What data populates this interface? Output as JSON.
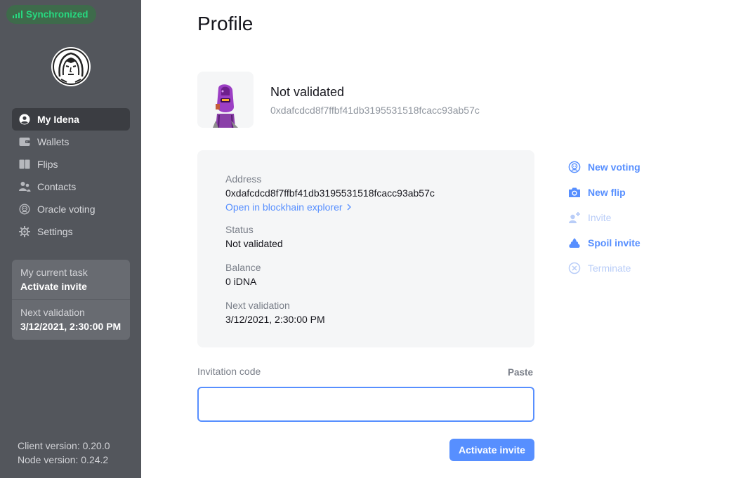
{
  "sidebar": {
    "sync_status": "Synchronized",
    "nav": [
      {
        "label": "My Idena",
        "icon": "user-circle-icon",
        "active": true
      },
      {
        "label": "Wallets",
        "icon": "wallet-icon"
      },
      {
        "label": "Flips",
        "icon": "flips-icon"
      },
      {
        "label": "Contacts",
        "icon": "contacts-icon"
      },
      {
        "label": "Oracle voting",
        "icon": "oracle-icon"
      },
      {
        "label": "Settings",
        "icon": "gear-icon"
      }
    ],
    "task": {
      "label": "My current task",
      "value": "Activate invite",
      "next_label": "Next validation",
      "next_value": "3/12/2021, 2:30:00 PM"
    },
    "client_version": "Client version: 0.20.0",
    "node_version": "Node version: 0.24.2"
  },
  "main": {
    "title": "Profile",
    "identity": {
      "status": "Not validated",
      "address": "0xdafcdcd8f7ffbf41db3195531518fcacc93ab57c"
    },
    "details": {
      "address_label": "Address",
      "address_value": "0xdafcdcd8f7ffbf41db3195531518fcacc93ab57c",
      "explorer_link": "Open in blockhain explorer",
      "status_label": "Status",
      "status_value": "Not validated",
      "balance_label": "Balance",
      "balance_value": "0 iDNA",
      "next_label": "Next validation",
      "next_value": "3/12/2021, 2:30:00 PM"
    },
    "actions": [
      {
        "label": "New voting",
        "icon": "voting-icon",
        "enabled": true
      },
      {
        "label": "New flip",
        "icon": "camera-icon",
        "enabled": true
      },
      {
        "label": "Invite",
        "icon": "add-user-icon",
        "enabled": false
      },
      {
        "label": "Spoil invite",
        "icon": "spoil-icon",
        "enabled": true
      },
      {
        "label": "Terminate",
        "icon": "terminate-icon",
        "enabled": false
      }
    ],
    "invitation": {
      "label": "Invitation code",
      "paste": "Paste",
      "value": "",
      "button": "Activate invite"
    }
  },
  "colors": {
    "sidebar": "#53565c",
    "accent": "#578fff",
    "sync_green": "#27d980",
    "card_bg": "#f5f6f7"
  }
}
